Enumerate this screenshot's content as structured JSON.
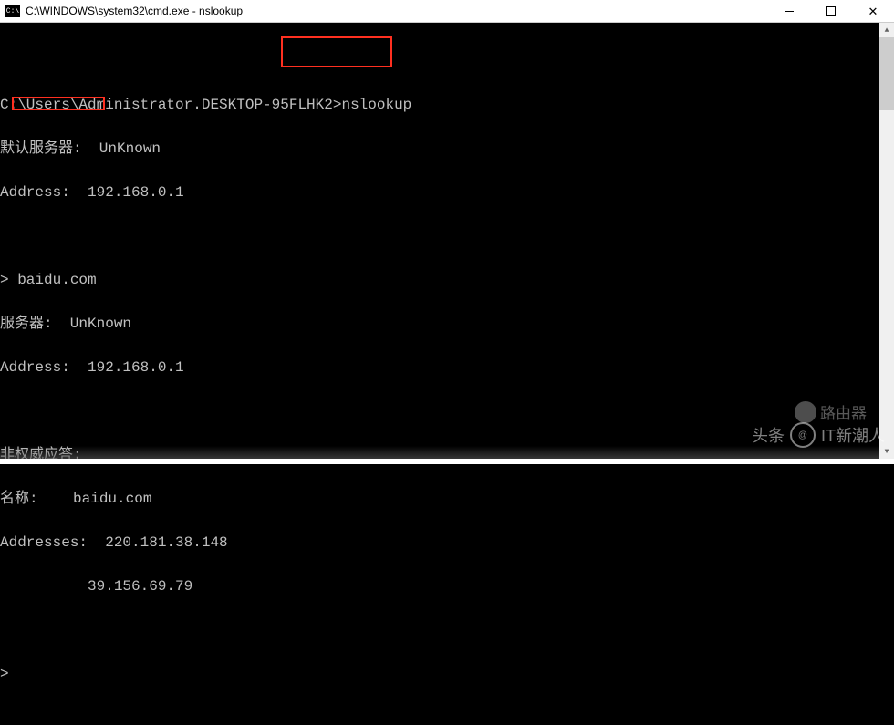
{
  "window": {
    "icon_label": "C:\\",
    "title": "C:\\WINDOWS\\system32\\cmd.exe - nslookup"
  },
  "terminal": {
    "prompt_path": "C:\\Users\\Administrator.DESKTOP-95FLHK2>",
    "cmd1": "nslookup",
    "line_default_server": "默认服务器:  UnKnown",
    "line_address1": "Address:  192.168.0.1",
    "prompt2": "> ",
    "query": "baidu.com",
    "line_server": "服务器:  UnKnown",
    "line_address2": "Address:  192.168.0.1",
    "line_nonauth": "非权威应答:",
    "line_name": "名称:    baidu.com",
    "line_addresses": "Addresses:  220.181.38.148",
    "line_addr2": "          39.156.69.79",
    "prompt3": "> "
  },
  "watermarks": {
    "w1": "路由器",
    "w2_left": "头条",
    "w2_right": "IT新潮人"
  }
}
